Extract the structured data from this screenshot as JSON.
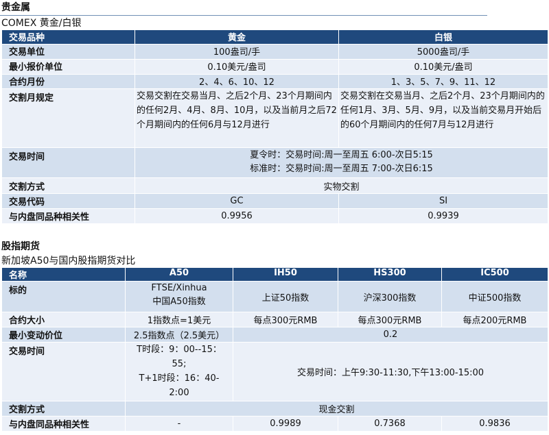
{
  "section1": {
    "title": "贵金属",
    "subtitle": "COMEX 黄金/白银",
    "header": {
      "label": "交易品种",
      "col1": "黄金",
      "col2": "白银"
    },
    "rows": {
      "unit": {
        "label": "交易单位",
        "gold": "100盎司/手",
        "silver": "5000盎司/手"
      },
      "tick": {
        "label": "最小报价单位",
        "gold": "0.10美元/盎司",
        "silver": "0.10美元/盎司"
      },
      "months": {
        "label": "合约月份",
        "gold": "2、4、6、10、12",
        "silver": "1、3、5、7、9、11、12"
      },
      "delivery_month": {
        "label": "交割月规定",
        "gold": "交易交割在交易当月、之后2个月、23个月期间内的任何2月、4月、8月、10月，以及当前月之后72个月期间内的任何6月与12月进行",
        "silver": "交易交割在交易当月、之后2个月、23个月期间内的任何1月、3月、5月、9月，以及当前交易月开始后的60个月期间内的任何7月与12月进行"
      },
      "hours": {
        "label": "交易时间",
        "line1": "夏令时：交易时间:周一至周五 6:00-次日5:15",
        "line2": "标准时：交易时间:周一至周五 7:00-次日6:15"
      },
      "settlement": {
        "label": "交割方式",
        "value": "实物交割"
      },
      "code": {
        "label": "交易代码",
        "gold": "GC",
        "silver": "SI"
      },
      "corr": {
        "label": "与内盘同品种相关性",
        "gold": "0.9956",
        "silver": "0.9939"
      }
    }
  },
  "section2": {
    "title": "股指期货",
    "subtitle": "新加坡A50与国内股指期货对比",
    "header": {
      "label": "名称",
      "c1": "A50",
      "c2": "IH50",
      "c3": "HS300",
      "c4": "IC500"
    },
    "rows": {
      "underlying": {
        "label": "标的",
        "c1_line1": "FTSE/Xinhua",
        "c1_line2": "中国A50指数",
        "c2": "上证50指数",
        "c3": "沪深300指数",
        "c4": "中证500指数"
      },
      "size": {
        "label": "合约大小",
        "c1": "1指数点=1美元",
        "c2": "每点300元RMB",
        "c3": "每点300元RMB",
        "c4": "每点200元RMB"
      },
      "tick": {
        "label": "最小变动价位",
        "c1": "2.5指数点（2.5美元）",
        "rest": "0.2"
      },
      "hours": {
        "label": "交易时间",
        "c1_l1": "T时段：9：00--15：",
        "c1_l2": "55;",
        "c1_l3": "T+1时段：16：40-",
        "c1_l4": "2:00",
        "rest": "交易时间：上午9:30-11:30,下午13:00-15:00"
      },
      "settlement": {
        "label": "交割方式",
        "value": "现金交割"
      },
      "corr": {
        "label": "与内盘同品种相关性",
        "c1": "-",
        "c2": "0.9989",
        "c3": "0.7368",
        "c4": "0.9836"
      }
    }
  }
}
